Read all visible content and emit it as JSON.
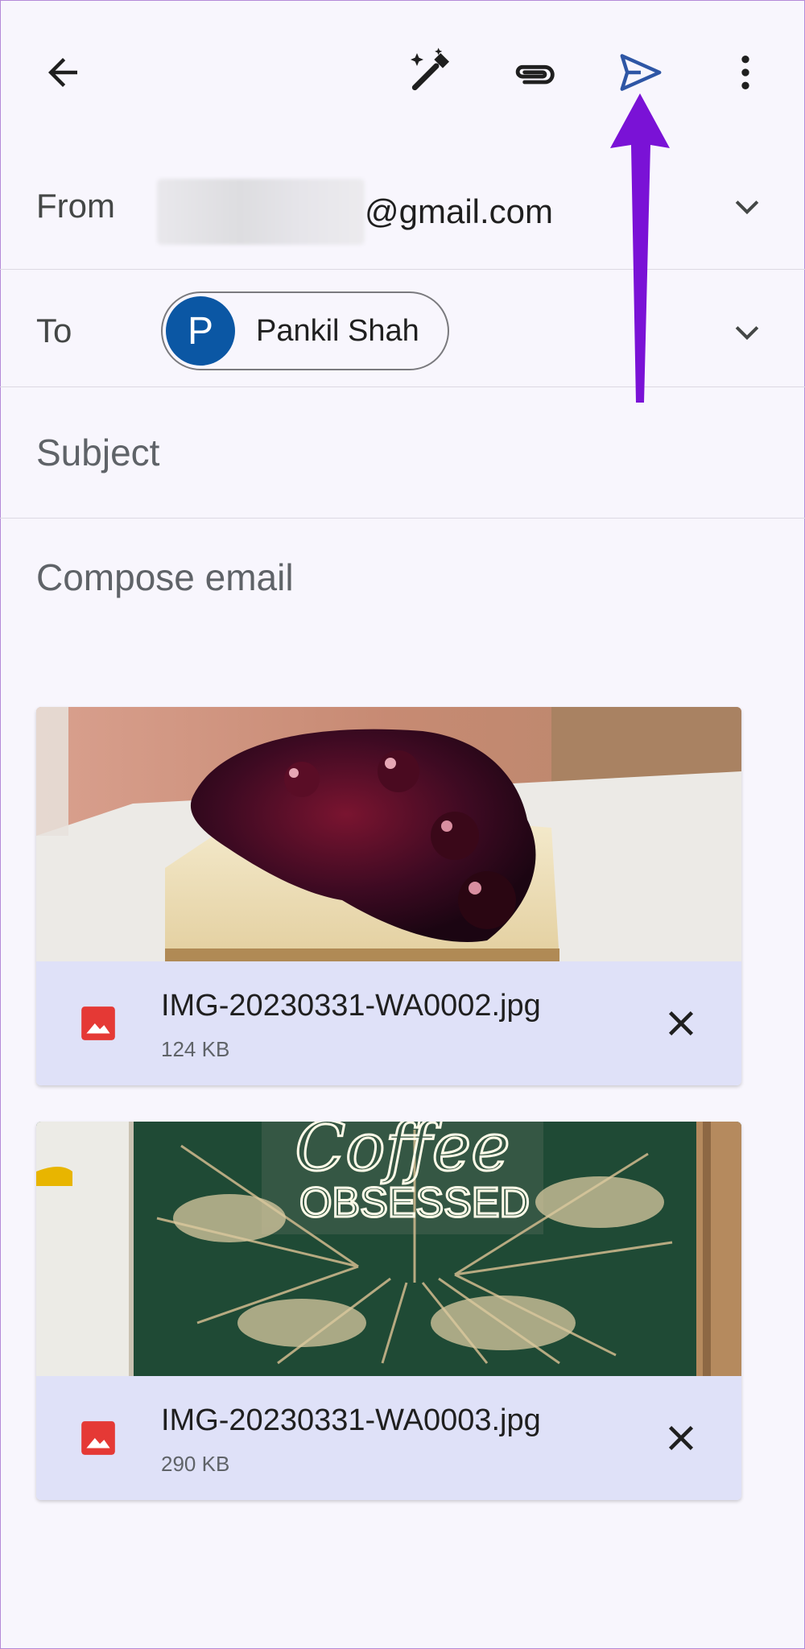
{
  "toolbar": {
    "back_icon": "arrow-left-icon",
    "magic_icon": "magic-pen-icon",
    "attach_icon": "paperclip-icon",
    "send_icon": "send-icon",
    "more_icon": "more-vert-icon"
  },
  "annotation": {
    "arrow_color": "#7a12d6"
  },
  "from": {
    "label": "From",
    "email_domain": "@gmail.com"
  },
  "to": {
    "label": "To",
    "avatar_letter": "P",
    "recipient": "Pankil Shah",
    "avatar_color": "#0b57a4"
  },
  "subject": {
    "placeholder": "Subject"
  },
  "body": {
    "placeholder": "Compose email"
  },
  "attachments": [
    {
      "name": "IMG-20230331-WA0002.jpg",
      "size": "124 KB"
    },
    {
      "name": "IMG-20230331-WA0003.jpg",
      "size": "290 KB"
    }
  ],
  "neon_sign": {
    "line1": "Coffee",
    "line2": "OBSESSED"
  },
  "colors": {
    "accent": "#0b57a4",
    "attachment_bar": "#dfe1f8",
    "image_icon": "#e53935"
  }
}
